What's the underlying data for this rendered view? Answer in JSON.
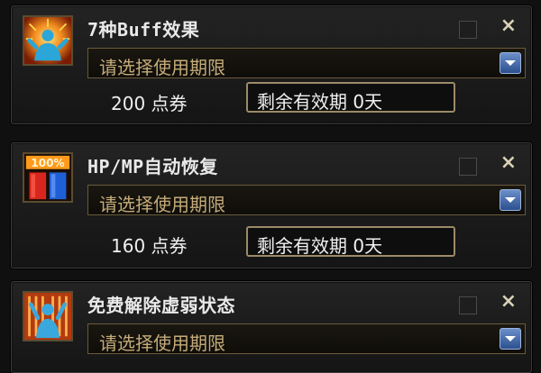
{
  "items": [
    {
      "title": "7种Buff效果",
      "icon": "buff-effect-icon",
      "select_placeholder": "请选择使用期限",
      "price": "200 点券",
      "expiry": "剩余有效期 0天"
    },
    {
      "title": "HP/MP自动恢复",
      "icon": "hp-mp-recovery-icon",
      "icon_text": "100%",
      "select_placeholder": "请选择使用期限",
      "price": "160 点券",
      "expiry": "剩余有效期 0天"
    },
    {
      "title": "免费解除虚弱状态",
      "icon": "weakness-removal-icon",
      "select_placeholder": "请选择使用期限"
    }
  ],
  "close_glyph": "×",
  "colors": {
    "accent_gold": "#c4ab78",
    "dropdown_blue": "#2c4f8e",
    "border_gold": "#9c8a67"
  }
}
